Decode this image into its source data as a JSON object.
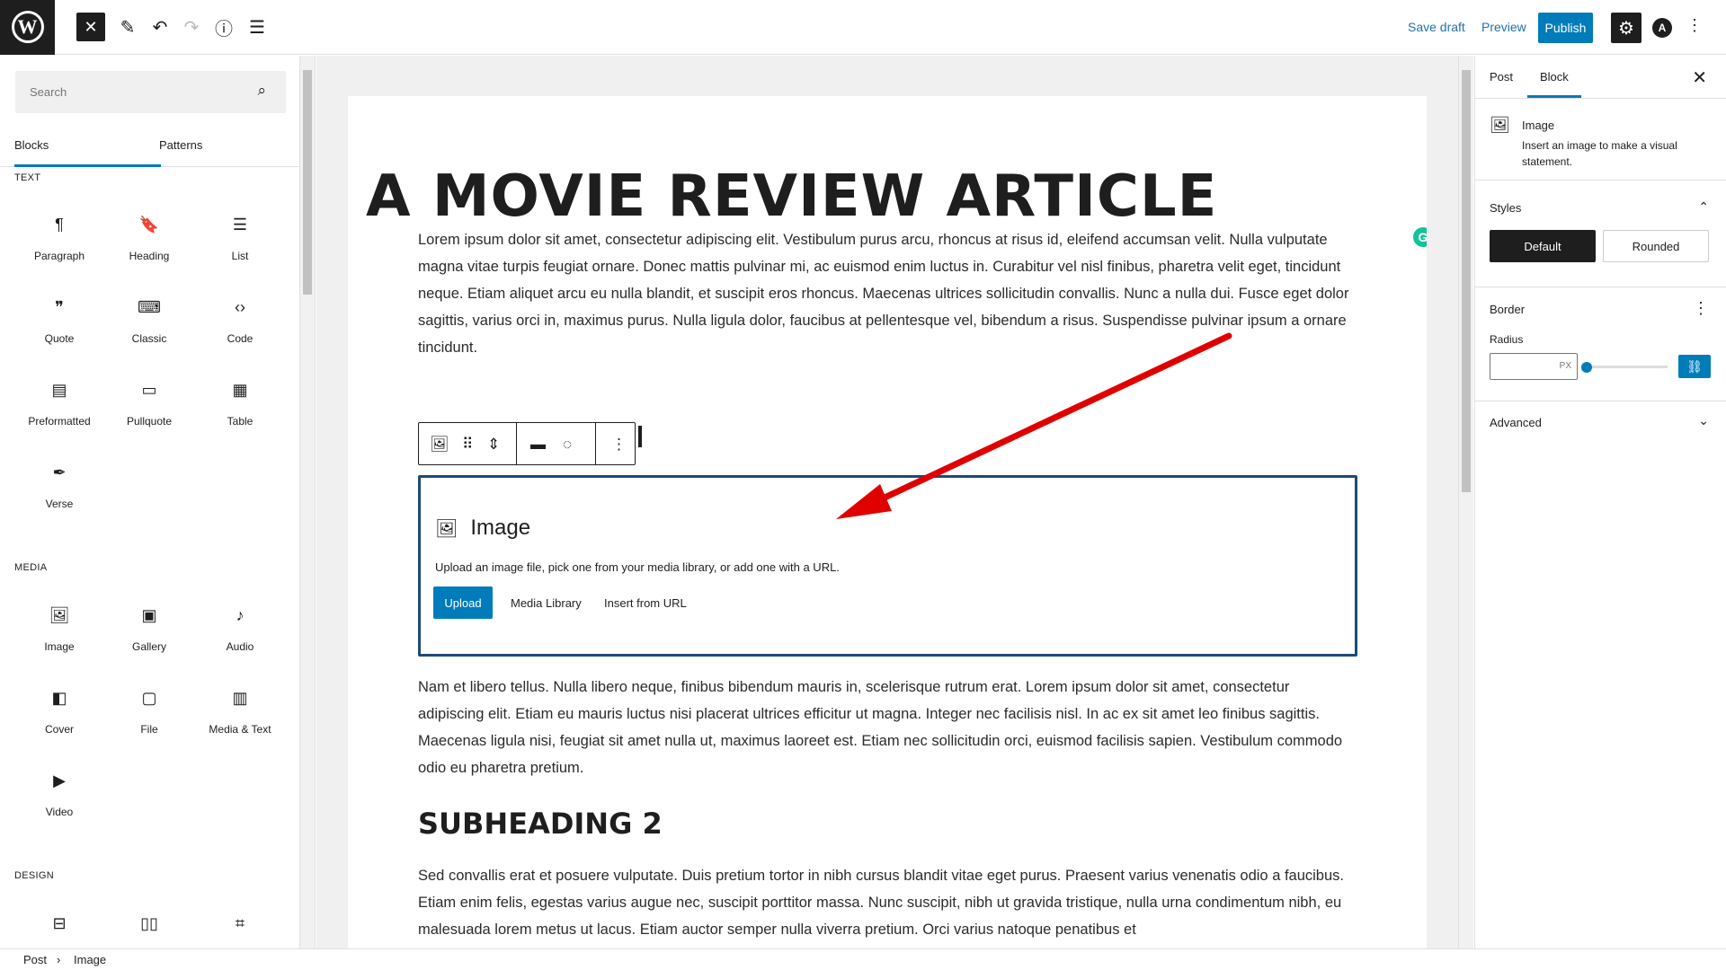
{
  "topbar": {
    "logo_glyph": "W",
    "close_glyph": "✕",
    "edit_glyph": "✎",
    "undo_glyph": "↶",
    "redo_glyph": "↷",
    "info_glyph": "ⓘ",
    "list_glyph": "☰",
    "save_draft": "Save draft",
    "preview": "Preview",
    "publish": "Publish",
    "settings_glyph": "⚙",
    "astra_glyph": "A",
    "more_glyph": "⋮"
  },
  "inserter": {
    "search_placeholder": "Search",
    "search_glyph": "⌕",
    "tabs": [
      "Blocks",
      "Patterns"
    ],
    "categories": {
      "text": "TEXT",
      "media": "MEDIA",
      "design": "DESIGN"
    },
    "text_blocks": [
      {
        "label": "Paragraph",
        "icon": "¶"
      },
      {
        "label": "Heading",
        "icon": "🔖"
      },
      {
        "label": "List",
        "icon": "☰"
      },
      {
        "label": "Quote",
        "icon": "❞"
      },
      {
        "label": "Classic",
        "icon": "⌨"
      },
      {
        "label": "Code",
        "icon": "‹›"
      },
      {
        "label": "Preformatted",
        "icon": "▤"
      },
      {
        "label": "Pullquote",
        "icon": "▭"
      },
      {
        "label": "Table",
        "icon": "▦"
      },
      {
        "label": "Verse",
        "icon": "✒"
      }
    ],
    "media_blocks": [
      {
        "label": "Image",
        "icon": "🖼"
      },
      {
        "label": "Gallery",
        "icon": "▣"
      },
      {
        "label": "Audio",
        "icon": "♪"
      },
      {
        "label": "Cover",
        "icon": "◧"
      },
      {
        "label": "File",
        "icon": "▢"
      },
      {
        "label": "Media & Text",
        "icon": "▥"
      },
      {
        "label": "Video",
        "icon": "▶"
      }
    ],
    "design_icons": [
      "⊟",
      "▯▯",
      "⌗"
    ]
  },
  "editor": {
    "title": "A MOVIE REVIEW ARTICLE",
    "paragraph1": "Lorem ipsum dolor sit amet, consectetur adipiscing elit. Vestibulum purus arcu, rhoncus at risus id, eleifend accumsan velit. Nulla vulputate magna vitae turpis feugiat ornare. Donec mattis pulvinar mi, ac euismod enim luctus in. Curabitur vel nisl finibus, pharetra velit eget, tincidunt neque. Etiam aliquet arcu eu nulla blandit, et suscipit eros rhoncus. Maecenas ultrices sollicitudin convallis. Nunc a nulla dui. Fusce eget dolor sagittis, varius orci in, maximus purus. Nulla ligula dolor, faucibus at pellentesque vel, bibendum a risus. Suspendisse pulvinar ipsum a ornare tincidunt.",
    "grammarly_glyph": "G",
    "block_toolbar": {
      "image_glyph": "🖼",
      "drag_glyph": "⠿",
      "move_glyph": "⇕",
      "align_glyph": "▬",
      "circle_glyph": "◌",
      "more_glyph": "⋮"
    },
    "image_block": {
      "icon": "🖼",
      "title": "Image",
      "description": "Upload an image file, pick one from your media library, or add one with a URL.",
      "upload": "Upload",
      "media_library": "Media Library",
      "insert_url": "Insert from URL"
    },
    "paragraph2": "Nam et libero tellus. Nulla libero neque, finibus bibendum mauris in, scelerisque rutrum erat. Lorem ipsum dolor sit amet, consectetur adipiscing elit. Etiam eu mauris luctus nisi placerat ultrices efficitur ut magna. Integer nec facilisis nisl. In ac ex sit amet leo finibus sagittis. Maecenas ligula nisi, feugiat sit amet nulla ut, maximus laoreet est. Etiam nec sollicitudin orci, euismod facilisis sapien. Vestibulum commodo odio eu pharetra pretium.",
    "subheading": "SUBHEADING 2",
    "paragraph3": "Sed convallis erat et posuere vulputate. Duis pretium tortor in nibh cursus blandit vitae eget purus. Praesent varius venenatis odio a faucibus. Etiam enim felis, egestas varius augue nec, suscipit porttitor massa. Nunc suscipit, nibh ut gravida tristique, nulla urna condimentum nibh, eu malesuada lorem metus ut lacus. Etiam auctor semper nulla viverra pretium. Orci varius natoque penatibus et"
  },
  "sidebar": {
    "tabs": [
      "Post",
      "Block"
    ],
    "close_glyph": "✕",
    "block_card": {
      "icon": "🖼",
      "title": "Image",
      "description": "Insert an image to make a visual statement."
    },
    "styles": {
      "heading": "Styles",
      "chevron": "⌃",
      "default": "Default",
      "rounded": "Rounded"
    },
    "border": {
      "heading": "Border",
      "more": "⋮",
      "radius_label": "Radius",
      "unit": "PX",
      "link_glyph": "⛓"
    },
    "advanced": {
      "heading": "Advanced",
      "chevron": "⌄"
    }
  },
  "footer": {
    "crumbs": [
      "Post",
      "Image"
    ],
    "separator": "›"
  },
  "colors": {
    "accent": "#007cba",
    "dark": "#1e1e1e",
    "annotation_arrow": "#e00000"
  }
}
